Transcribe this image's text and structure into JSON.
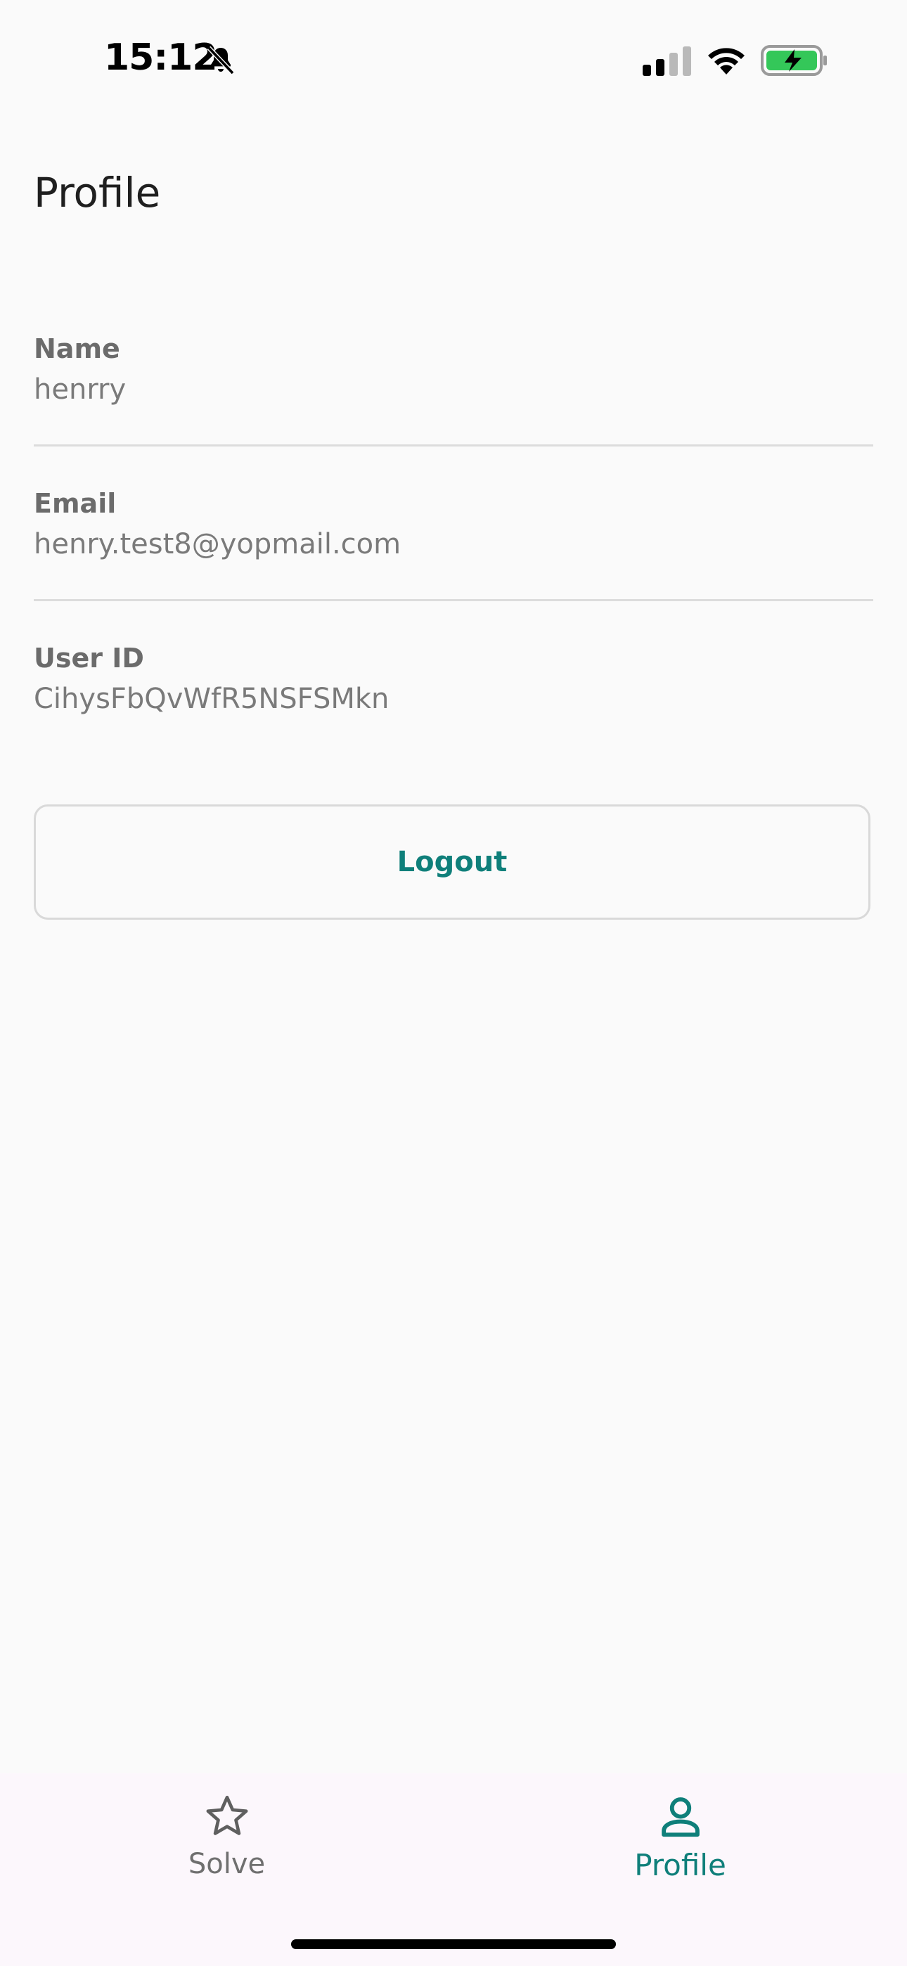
{
  "status_bar": {
    "time": "15:12",
    "icons": [
      "bell-slash-icon",
      "cellular-signal-icon",
      "wifi-icon",
      "battery-charging-icon"
    ],
    "battery_color": "#34c759"
  },
  "page": {
    "title": "Profile"
  },
  "fields": {
    "name": {
      "label": "Name",
      "value": "henrry"
    },
    "email": {
      "label": "Email",
      "value": "henry.test8@yopmail.com"
    },
    "user_id": {
      "label": "User ID",
      "value": "CihysFbQvWfR5NSFSMkn"
    }
  },
  "actions": {
    "logout_label": "Logout"
  },
  "bottom_nav": {
    "items": [
      {
        "label": "Solve",
        "icon": "star-icon",
        "active": false
      },
      {
        "label": "Profile",
        "icon": "person-icon",
        "active": true
      }
    ]
  },
  "colors": {
    "accent": "#0f7f7a",
    "background": "#fafafa",
    "nav_background": "#fcf7fc",
    "inactive": "#6f6f6f"
  }
}
